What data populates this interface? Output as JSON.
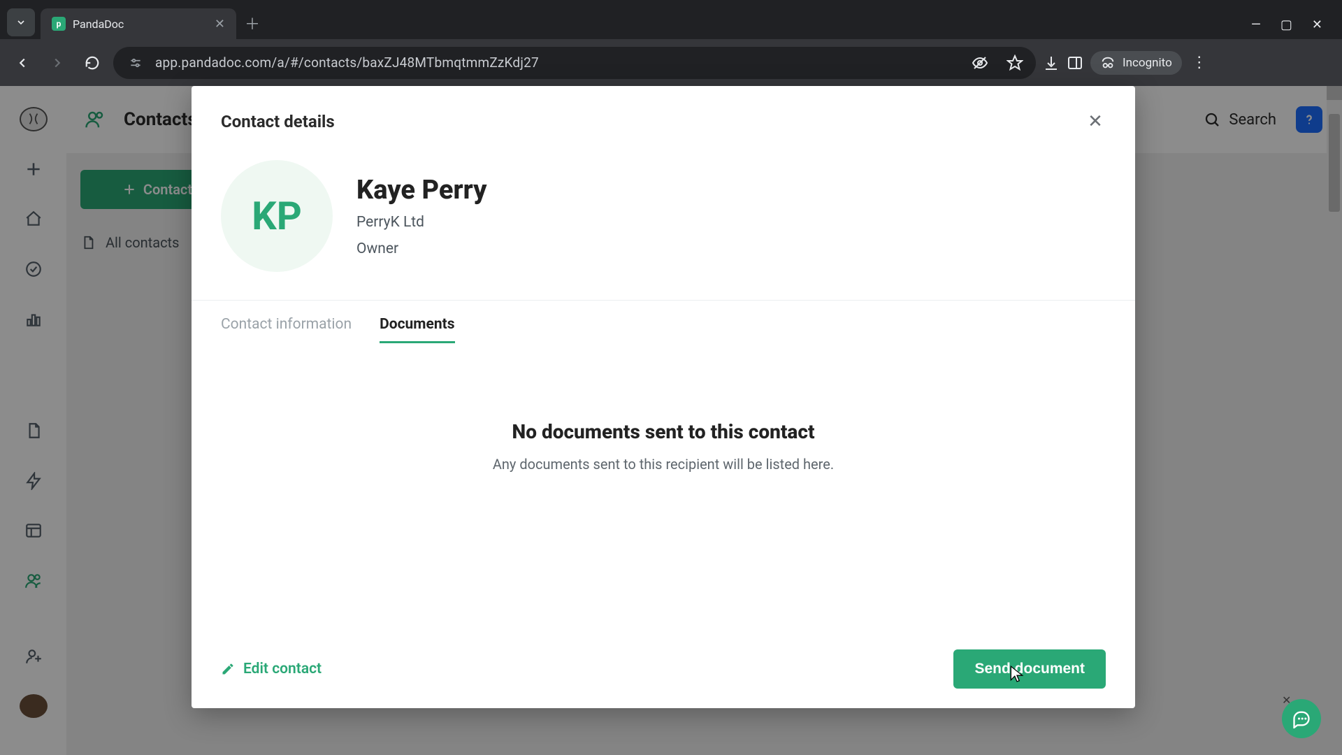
{
  "browser": {
    "tab_title": "PandaDoc",
    "url": "app.pandadoc.com/a/#/contacts/baxZJ48MTbmqtmmZzKdj27",
    "incognito_label": "Incognito"
  },
  "background": {
    "page_title": "Contacts",
    "add_contact_button": "Contact",
    "side_item_all": "All contacts",
    "search_label": "Search"
  },
  "modal": {
    "title": "Contact details",
    "avatar_initials": "KP",
    "name": "Kaye Perry",
    "company": "PerryK Ltd",
    "role": "Owner",
    "tabs": {
      "info": "Contact information",
      "docs": "Documents",
      "active": "docs"
    },
    "empty_title": "No documents sent to this contact",
    "empty_sub": "Any documents sent to this recipient will be listed here.",
    "edit_label": "Edit contact",
    "send_label": "Send document"
  },
  "colors": {
    "brand_green": "#2aa876",
    "brand_blue": "#1d6dff"
  }
}
